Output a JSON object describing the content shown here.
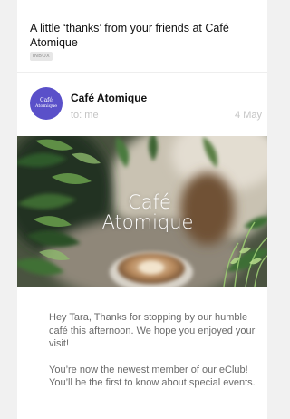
{
  "email": {
    "subject": "A little ‘thanks’ from your friends at Café Atomique",
    "label": "INBOX",
    "sender": {
      "name": "Café Atomique",
      "to": "to: me",
      "date": "4 May",
      "avatar_line1": "Café",
      "avatar_line2": "Atomique"
    },
    "hero": {
      "line1": "Café",
      "line2": "Atomique"
    },
    "body": {
      "paragraph1": "Hey Tara, Thanks for stopping by our humble café this afternoon. We hope you enjoyed your visit!",
      "paragraph2": "You’re now the newest member of our eClub! You’ll be the first to know about special events."
    }
  },
  "colors": {
    "avatar_bg": "#5a50c9",
    "page_bg": "#f1f1f1",
    "card_bg": "#ffffff",
    "muted_text": "#c4c4c4",
    "body_text": "#6a6a6a"
  }
}
